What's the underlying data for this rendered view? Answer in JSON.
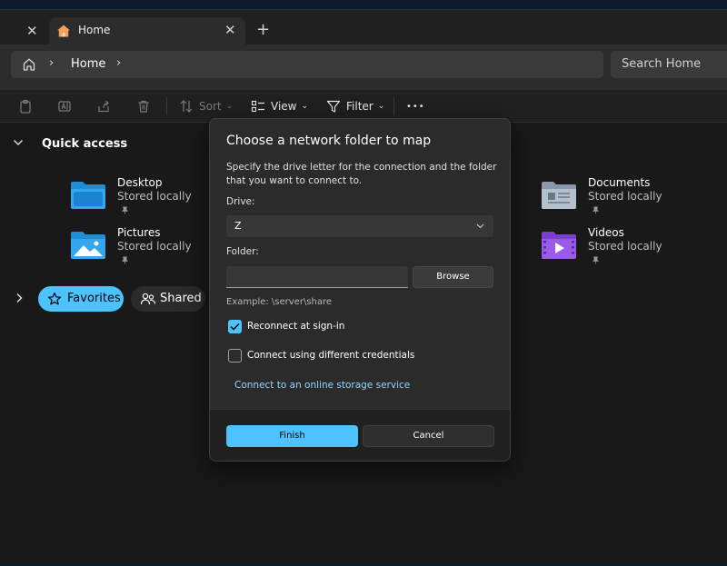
{
  "tabs": {
    "previous_close": "✕",
    "home_label": "Home",
    "home_close": "✕",
    "new_tab": "+"
  },
  "address": {
    "chevron": "›",
    "crumb": "Home",
    "search_placeholder": "Search Home"
  },
  "toolbar": {
    "sort_label": "Sort",
    "view_label": "View",
    "filter_label": "Filter",
    "more_label": "•••",
    "dropdown_glyph": "⌄"
  },
  "quick_access": {
    "title": "Quick access",
    "folders": [
      {
        "name": "Desktop",
        "status": "Stored locally",
        "icon": "desktop-folder-icon"
      },
      {
        "name": "Pictures",
        "status": "Stored locally",
        "icon": "pictures-folder-icon"
      },
      {
        "name": "Documents",
        "status": "Stored locally",
        "icon": "documents-folder-icon"
      },
      {
        "name": "Videos",
        "status": "Stored locally",
        "icon": "videos-folder-icon"
      }
    ]
  },
  "filters": {
    "favorites_label": "Favorites",
    "shared_label": "Shared"
  },
  "dialog": {
    "title": "Choose a network folder to map",
    "description": "Specify the drive letter for the connection and the folder that you want to connect to.",
    "drive_label": "Drive:",
    "drive_value": "Z",
    "folder_label": "Folder:",
    "folder_value": "",
    "browse_label": "Browse",
    "example": "Example: \\server\\share",
    "reconnect_label": "Reconnect at sign-in",
    "reconnect_checked": true,
    "credentials_label": "Connect using different credentials",
    "credentials_checked": false,
    "online_link": "Connect to an online storage service",
    "finish_label": "Finish",
    "cancel_label": "Cancel"
  },
  "colors": {
    "accent": "#4cc2ff",
    "window_bg": "#191919",
    "dialog_bg": "#2b2b2b"
  }
}
